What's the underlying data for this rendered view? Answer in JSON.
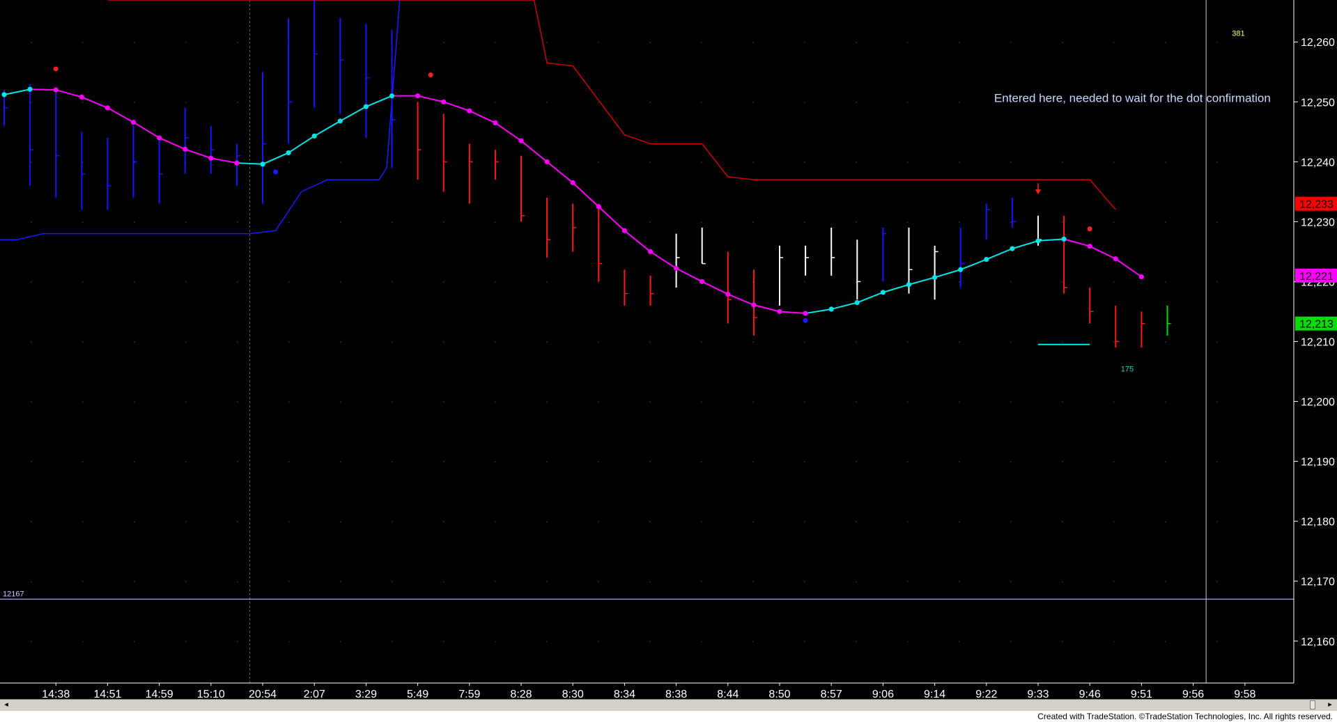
{
  "app": {
    "footer_text": "Created with TradeStation. ©TradeStation Technologies, Inc. All rights reserved."
  },
  "colors": {
    "background": "#000000",
    "axis_text": "#ffffff",
    "grid_dot": "#3a3a3a",
    "up_bar": "#1515ff",
    "down_bar": "#ff1818",
    "neutral_bar": "#ffffff",
    "ma_up": "#00e5e5",
    "ma_down": "#ff00ff",
    "upper_band": "#d00000",
    "lower_band": "#1a1aff",
    "ref_line": "#c8c8ff",
    "annotation": "#c8d8ff"
  },
  "chart_data": {
    "type": "bar",
    "subtype": "ohlc",
    "ylim": [
      12153,
      12267
    ],
    "y_ticks": [
      12160,
      12170,
      12180,
      12190,
      12200,
      12210,
      12220,
      12230,
      12240,
      12250,
      12260
    ],
    "y_tick_labels": [
      "12,160",
      "12,170",
      "12,180",
      "12,190",
      "12,200",
      "12,210",
      "12,220",
      "12,230",
      "12,240",
      "12,250",
      "12,260"
    ],
    "x_labels": [
      "14:38",
      "14:51",
      "14:59",
      "15:10",
      "20:54",
      "2:07",
      "3:29",
      "5:49",
      "7:59",
      "8:28",
      "8:30",
      "8:34",
      "8:38",
      "8:44",
      "8:50",
      "8:57",
      "9:06",
      "9:14",
      "9:22",
      "9:33",
      "9:46",
      "9:51",
      "9:56",
      "9:58"
    ],
    "bars": [
      {
        "h": 12252,
        "l": 12246,
        "c": 12249,
        "color": "up"
      },
      {
        "h": 12253,
        "l": 12236,
        "c": 12242,
        "color": "up"
      },
      {
        "h": 12252,
        "l": 12234,
        "c": 12241,
        "color": "up"
      },
      {
        "h": 12245,
        "l": 12232,
        "c": 12238,
        "color": "up"
      },
      {
        "h": 12244,
        "l": 12232,
        "c": 12236,
        "color": "up"
      },
      {
        "h": 12246,
        "l": 12234,
        "c": 12240,
        "color": "up"
      },
      {
        "h": 12244,
        "l": 12233,
        "c": 12238,
        "color": "up"
      },
      {
        "h": 12249,
        "l": 12238,
        "c": 12244,
        "color": "up"
      },
      {
        "h": 12246,
        "l": 12238,
        "c": 12242,
        "color": "up"
      },
      {
        "h": 12243,
        "l": 12236,
        "c": 12241,
        "color": "up"
      },
      {
        "h": 12255,
        "l": 12233,
        "c": 12243,
        "color": "up"
      },
      {
        "h": 12264,
        "l": 12243,
        "c": 12250,
        "color": "up"
      },
      {
        "h": 12267,
        "l": 12249,
        "c": 12258,
        "color": "up"
      },
      {
        "h": 12264,
        "l": 12248,
        "c": 12257,
        "color": "up"
      },
      {
        "h": 12263,
        "l": 12244,
        "c": 12254,
        "color": "up"
      },
      {
        "h": 12262,
        "l": 12239,
        "c": 12247,
        "color": "up"
      },
      {
        "h": 12250,
        "l": 12237,
        "c": 12242,
        "color": "down"
      },
      {
        "h": 12248,
        "l": 12235,
        "c": 12240,
        "color": "down"
      },
      {
        "h": 12243,
        "l": 12233,
        "c": 12240,
        "color": "down"
      },
      {
        "h": 12242,
        "l": 12237,
        "c": 12240,
        "color": "down"
      },
      {
        "h": 12241,
        "l": 12230,
        "c": 12231,
        "color": "down"
      },
      {
        "h": 12234,
        "l": 12224,
        "c": 12227,
        "color": "down"
      },
      {
        "h": 12233,
        "l": 12225,
        "c": 12229,
        "color": "down"
      },
      {
        "h": 12233,
        "l": 12220,
        "c": 12223,
        "color": "down"
      },
      {
        "h": 12222,
        "l": 12216,
        "c": 12218,
        "color": "down"
      },
      {
        "h": 12221,
        "l": 12216,
        "c": 12218,
        "color": "down"
      },
      {
        "h": 12228,
        "l": 12219,
        "c": 12224,
        "color": "neutral"
      },
      {
        "h": 12229,
        "l": 12223,
        "c": 12223,
        "color": "neutral"
      },
      {
        "h": 12225,
        "l": 12213,
        "c": 12217,
        "color": "down"
      },
      {
        "h": 12222,
        "l": 12211,
        "c": 12214,
        "color": "down"
      },
      {
        "h": 12226,
        "l": 12216,
        "c": 12224,
        "color": "neutral"
      },
      {
        "h": 12226,
        "l": 12221,
        "c": 12224,
        "color": "neutral"
      },
      {
        "h": 12229,
        "l": 12221,
        "c": 12224,
        "color": "neutral"
      },
      {
        "h": 12227,
        "l": 12217,
        "c": 12220,
        "color": "neutral"
      },
      {
        "h": 12229,
        "l": 12220,
        "c": 12228,
        "color": "up"
      },
      {
        "h": 12229,
        "l": 12218,
        "c": 12222,
        "color": "neutral"
      },
      {
        "h": 12226,
        "l": 12217,
        "c": 12225,
        "color": "neutral"
      },
      {
        "h": 12229,
        "l": 12219,
        "c": 12223,
        "color": "up"
      },
      {
        "h": 12233,
        "l": 12227,
        "c": 12232,
        "color": "up"
      },
      {
        "h": 12234,
        "l": 12229,
        "c": 12230,
        "color": "up"
      },
      {
        "h": 12231,
        "l": 12226,
        "c": 12227,
        "color": "neutral"
      },
      {
        "h": 12231,
        "l": 12218,
        "c": 12219,
        "color": "down"
      },
      {
        "h": 12219,
        "l": 12213,
        "c": 12215,
        "color": "down"
      },
      {
        "h": 12216,
        "l": 12209,
        "c": 12210,
        "color": "down"
      },
      {
        "h": 12215,
        "l": 12209,
        "c": 12213,
        "color": "down"
      },
      {
        "h": 12216,
        "l": 12211,
        "c": 12213,
        "color": "green"
      }
    ],
    "ma_points": [
      {
        "v": 12251.2,
        "trend": "up"
      },
      {
        "v": 12252.1,
        "trend": "up"
      },
      {
        "v": 12252.0,
        "trend": "down"
      },
      {
        "v": 12250.8,
        "trend": "down"
      },
      {
        "v": 12249.0,
        "trend": "down"
      },
      {
        "v": 12246.6,
        "trend": "down"
      },
      {
        "v": 12244.0,
        "trend": "down"
      },
      {
        "v": 12242.1,
        "trend": "down"
      },
      {
        "v": 12240.6,
        "trend": "down"
      },
      {
        "v": 12239.8,
        "trend": "down"
      },
      {
        "v": 12239.6,
        "trend": "up"
      },
      {
        "v": 12241.5,
        "trend": "up"
      },
      {
        "v": 12244.3,
        "trend": "up"
      },
      {
        "v": 12246.8,
        "trend": "up"
      },
      {
        "v": 12249.2,
        "trend": "up"
      },
      {
        "v": 12251.0,
        "trend": "up"
      },
      {
        "v": 12251.0,
        "trend": "down"
      },
      {
        "v": 12250.0,
        "trend": "down"
      },
      {
        "v": 12248.5,
        "trend": "down"
      },
      {
        "v": 12246.5,
        "trend": "down"
      },
      {
        "v": 12243.5,
        "trend": "down"
      },
      {
        "v": 12240.0,
        "trend": "down"
      },
      {
        "v": 12236.5,
        "trend": "down"
      },
      {
        "v": 12232.5,
        "trend": "down"
      },
      {
        "v": 12228.5,
        "trend": "down"
      },
      {
        "v": 12225.0,
        "trend": "down"
      },
      {
        "v": 12222.2,
        "trend": "down"
      },
      {
        "v": 12220.0,
        "trend": "down"
      },
      {
        "v": 12217.9,
        "trend": "down"
      },
      {
        "v": 12216.1,
        "trend": "down"
      },
      {
        "v": 12215.0,
        "trend": "down"
      },
      {
        "v": 12214.7,
        "trend": "down"
      },
      {
        "v": 12215.4,
        "trend": "up"
      },
      {
        "v": 12216.5,
        "trend": "up"
      },
      {
        "v": 12218.2,
        "trend": "up"
      },
      {
        "v": 12219.5,
        "trend": "up"
      },
      {
        "v": 12220.7,
        "trend": "up"
      },
      {
        "v": 12222.0,
        "trend": "up"
      },
      {
        "v": 12223.7,
        "trend": "up"
      },
      {
        "v": 12225.5,
        "trend": "up"
      },
      {
        "v": 12226.8,
        "trend": "up"
      },
      {
        "v": 12227.1,
        "trend": "up"
      },
      {
        "v": 12225.9,
        "trend": "down"
      },
      {
        "v": 12223.8,
        "trend": "down"
      },
      {
        "v": 12220.8,
        "trend": "down"
      }
    ],
    "upper_band": [
      [
        4,
        12267
      ],
      [
        20.5,
        12267
      ],
      [
        21,
        12256.5
      ],
      [
        22,
        12256
      ],
      [
        24,
        12244.5
      ],
      [
        25,
        12243
      ],
      [
        27,
        12243
      ],
      [
        28,
        12237.5
      ],
      [
        29,
        12237
      ],
      [
        42,
        12237
      ],
      [
        43,
        12232
      ]
    ],
    "lower_band": [
      [
        -0.5,
        12227
      ],
      [
        0.5,
        12227
      ],
      [
        1.5,
        12228
      ],
      [
        9.5,
        12228
      ],
      [
        10.5,
        12228.5
      ],
      [
        11.5,
        12235
      ],
      [
        12.5,
        12237
      ],
      [
        14.5,
        12237
      ],
      [
        14.8,
        12239
      ],
      [
        15.3,
        12267
      ]
    ],
    "ref_line": {
      "value": 12167,
      "label": "12167"
    },
    "dividers": [
      9.5,
      46.5
    ],
    "price_markers": [
      {
        "value": 12233,
        "label": "12,233",
        "color": "#ff0000",
        "text_color": "#000000"
      },
      {
        "value": 12221,
        "label": "12,221",
        "color": "#ff00ff",
        "text_color": "#000000"
      },
      {
        "value": 12213,
        "label": "12,213",
        "color": "#00dd00",
        "text_color": "#000000"
      }
    ],
    "dots": [
      {
        "i": 2,
        "v": 12255.5,
        "color": "#ff2020"
      },
      {
        "i": 10.5,
        "v": 12238.3,
        "color": "#1a1aff"
      },
      {
        "i": 16.5,
        "v": 12254.5,
        "color": "#ff2020"
      },
      {
        "i": 31,
        "v": 12213.5,
        "color": "#1a1aff"
      },
      {
        "i": 42,
        "v": 12228.8,
        "color": "#ff2020"
      }
    ],
    "target_line": {
      "i_start": 40,
      "i_end": 42,
      "v": 12209.5,
      "color": "#00e5e5"
    },
    "sell_arrow": {
      "i": 40,
      "v": 12235.5,
      "color": "#ff2020"
    },
    "labels": [
      {
        "text": "381",
        "i": 47.5,
        "v": 12261,
        "color": "#ffff66"
      },
      {
        "text": "175",
        "i": 43.2,
        "v": 12205,
        "color": "#33cccc"
      }
    ],
    "annotation": {
      "text": "Entered here, needed to wait for the dot confirmation",
      "i": 38.3,
      "v": 12250
    }
  }
}
